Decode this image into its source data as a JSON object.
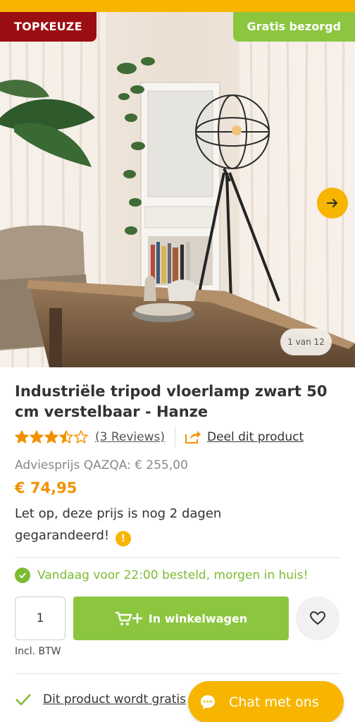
{
  "badges": {
    "top_choice": "TOPKEUZE",
    "free_delivery": "Gratis bezorgd"
  },
  "gallery": {
    "counter": "1 van 12",
    "next_icon": "arrow-right-icon"
  },
  "product": {
    "title": "Industriële tripod vloerlamp zwart 50 cm verstelbaar - Hanze",
    "rating": 3.5,
    "rating_max": 5,
    "reviews_label": "(3 Reviews)",
    "share_label": "Deel dit product",
    "advice_price": "Adviesprijs QAZQA:  € 255,00",
    "price": "€ 74,95",
    "price_note": "Let op, deze prijs is nog 2 dagen gegarandeerd!",
    "info_icon": "!"
  },
  "delivery": {
    "text": "Vandaag voor 22:00 besteld, morgen in huis!"
  },
  "purchase": {
    "quantity": "1",
    "add_to_cart": "In winkelwagen",
    "vat_label": "Incl. BTW"
  },
  "usp": {
    "free_text": "Dit product wordt gratis"
  },
  "chat": {
    "label": "Chat met ons"
  },
  "colors": {
    "accent": "#f7b500",
    "brand_green": "#8cc63f",
    "badge_red": "#9b0e12",
    "price_orange": "#f29100"
  }
}
